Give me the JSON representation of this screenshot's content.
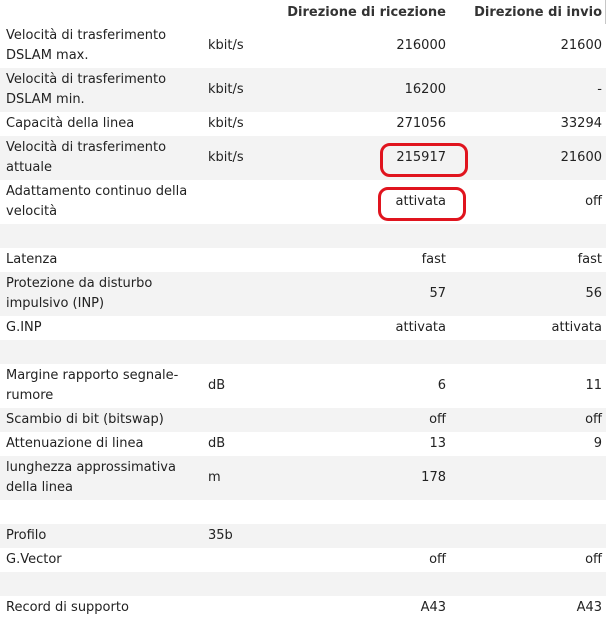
{
  "header": {
    "recv": "Direzione di ricezione",
    "send": "Direzione di invio"
  },
  "rows": [
    {
      "label": "Velocità di trasferimento DSLAM max.",
      "unit": "kbit/s",
      "recv": "216000",
      "send": "21600"
    },
    {
      "label": "Velocità di trasferimento DSLAM min.",
      "unit": "kbit/s",
      "recv": "16200",
      "send": "-"
    },
    {
      "label": "Capacità della linea",
      "unit": "kbit/s",
      "recv": "271056",
      "send": "33294"
    },
    {
      "label": "Velocità di trasferimento attuale",
      "unit": "kbit/s",
      "recv": "215917",
      "send": "21600"
    },
    {
      "label": "Adattamento continuo della velocità",
      "unit": "",
      "recv": "attivata",
      "send": "off"
    },
    {
      "label": "",
      "unit": "",
      "recv": "",
      "send": ""
    },
    {
      "label": "Latenza",
      "unit": "",
      "recv": "fast",
      "send": "fast"
    },
    {
      "label": "Protezione da disturbo impulsivo (INP)",
      "unit": "",
      "recv": "57",
      "send": "56"
    },
    {
      "label": "G.INP",
      "unit": "",
      "recv": "attivata",
      "send": "attivata"
    },
    {
      "label": "",
      "unit": "",
      "recv": "",
      "send": ""
    },
    {
      "label": "Margine rapporto segnale-rumore",
      "unit": "dB",
      "recv": "6",
      "send": "11"
    },
    {
      "label": "Scambio di bit (bitswap)",
      "unit": "",
      "recv": "off",
      "send": "off"
    },
    {
      "label": "Attenuazione di linea",
      "unit": "dB",
      "recv": "13",
      "send": "9"
    },
    {
      "label": "lunghezza approssimativa della linea",
      "unit": "m",
      "recv": "178",
      "send": ""
    },
    {
      "label": "",
      "unit": "",
      "recv": "",
      "send": ""
    },
    {
      "label": "Profilo",
      "unit": "35b",
      "recv": "",
      "send": ""
    },
    {
      "label": "G.Vector",
      "unit": "",
      "recv": "off",
      "send": "off"
    },
    {
      "label": "",
      "unit": "",
      "recv": "",
      "send": ""
    },
    {
      "label": "Record di supporto",
      "unit": "",
      "recv": "A43",
      "send": "A43"
    }
  ],
  "colors": {
    "row_alt": "#f3f3f3",
    "highlight": "#e0141e"
  }
}
